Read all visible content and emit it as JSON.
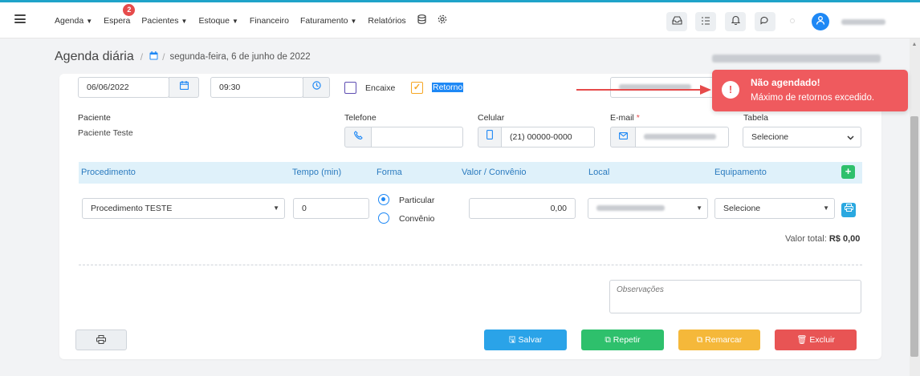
{
  "nav": {
    "menu": [
      {
        "label": "Agenda",
        "caret": "▼"
      },
      {
        "label": "Espera",
        "caret": "",
        "badge": "2"
      },
      {
        "label": "Pacientes",
        "caret": "▼"
      },
      {
        "label": "Estoque",
        "caret": "▼"
      },
      {
        "label": "Financeiro",
        "caret": ""
      },
      {
        "label": "Faturamento",
        "caret": "▼"
      },
      {
        "label": "Relatórios",
        "caret": ""
      }
    ],
    "icons": [
      "database-icon",
      "gear-icon",
      "inbox-icon",
      "list-icon",
      "bell-icon",
      "chat-icon",
      "user-avatar-icon"
    ]
  },
  "breadcrumb": {
    "title": "Agenda diária",
    "separator": "/",
    "date": "segunda-feira, 6 de junho de 2022"
  },
  "form": {
    "date_value": "06/06/2022",
    "time_value": "09:30",
    "encaixe_label": "Encaixe",
    "retorno_label": "Retorno",
    "paciente_label": "Paciente",
    "paciente_value": "Paciente Teste",
    "telefone_label": "Telefone",
    "celular_label": "Celular",
    "celular_value": "(21) 00000-0000",
    "email_label": "E-mail",
    "required_mark": "*",
    "tabela_label": "Tabela",
    "tabela_value": "Selecione"
  },
  "table": {
    "headers": [
      "Procedimento",
      "Tempo (min)",
      "Forma",
      "Valor / Convênio",
      "Local",
      "Equipamento"
    ],
    "row": {
      "procedimento": "Procedimento TESTE",
      "tempo": "0",
      "forma_particular": "Particular",
      "forma_convenio": "Convênio",
      "valor": "0,00",
      "equipamento": "Selecione"
    },
    "total_label": "Valor total:",
    "total_value": "R$ 0,00"
  },
  "observacoes_placeholder": "Observações",
  "buttons": {
    "salvar": "Salvar",
    "repetir": "Repetir",
    "remarcar": "Remarcar",
    "excluir": "Excluir"
  },
  "toast": {
    "title": "Não agendado!",
    "message": "Máximo de retornos excedido."
  },
  "colors": {
    "accent": "#1e88f5",
    "salvar": "#2aa3e8",
    "repetir": "#2ec06c",
    "remarcar": "#f5b83a",
    "excluir": "#e85454",
    "toast": "#ef5a5e",
    "table_header_bg": "#dff1fa"
  }
}
